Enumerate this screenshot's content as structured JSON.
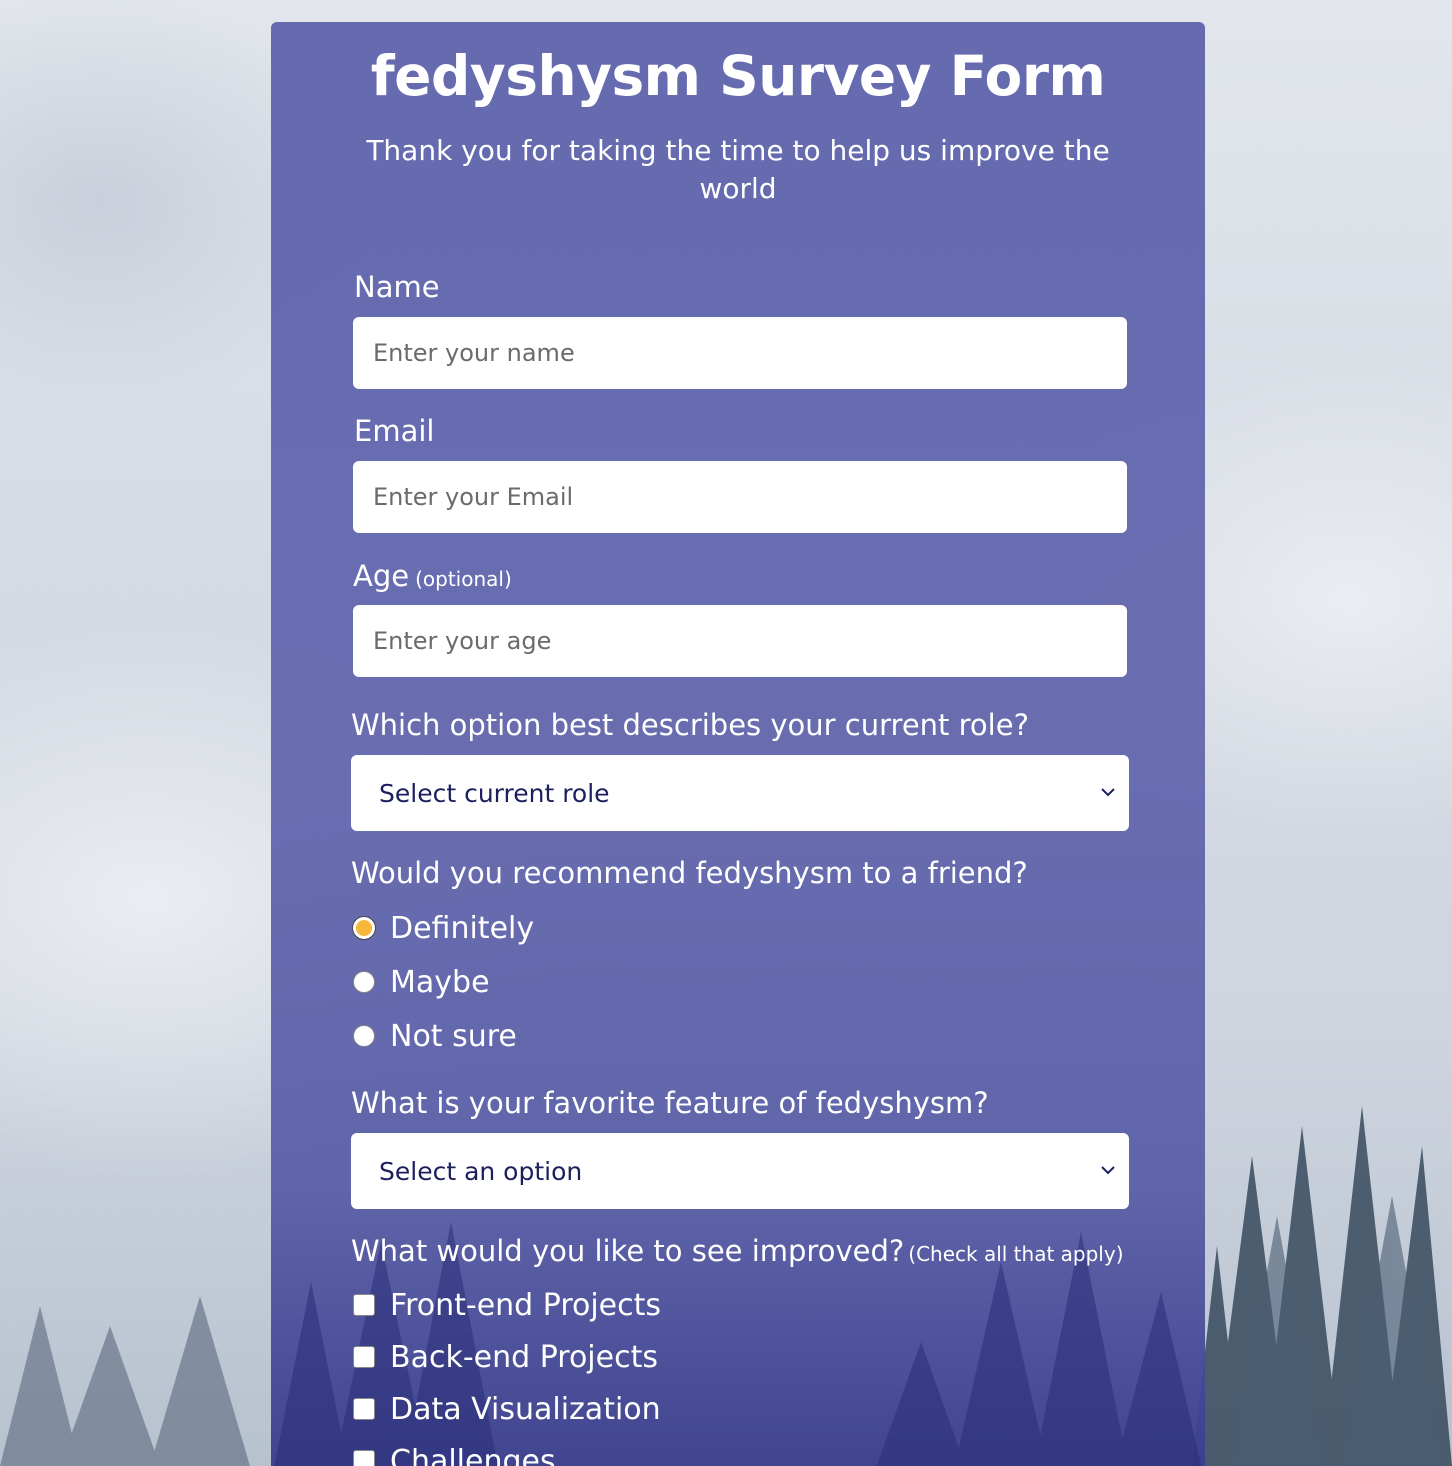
{
  "form": {
    "title": "fedyshysm Survey Form",
    "description": "Thank you for taking the time to help us improve the world",
    "name": {
      "label": "Name",
      "placeholder": "Enter your name"
    },
    "email": {
      "label": "Email",
      "placeholder": "Enter your Email"
    },
    "age": {
      "label": "Age",
      "note": "(optional)",
      "placeholder": "Enter your age"
    },
    "role": {
      "question": "Which option best describes your current role?",
      "selected": "Select current role"
    },
    "recommend": {
      "question": "Would you recommend fedyshysm to a friend?",
      "options": [
        {
          "label": "Definitely",
          "checked": true
        },
        {
          "label": "Maybe",
          "checked": false
        },
        {
          "label": "Not sure",
          "checked": false
        }
      ]
    },
    "feature": {
      "question": "What is your favorite feature of fedyshysm?",
      "selected": "Select an option"
    },
    "improve": {
      "question": "What would you like to see improved?",
      "note": "(Check all that apply)",
      "options": [
        {
          "label": "Front-end Projects",
          "checked": false
        },
        {
          "label": "Back-end Projects",
          "checked": false
        },
        {
          "label": "Data Visualization",
          "checked": false
        },
        {
          "label": "Challenges",
          "checked": false
        }
      ]
    }
  },
  "colors": {
    "card": "#5e62aa",
    "radio_checked": "#f5b73b",
    "select_text": "#1b1f5e"
  }
}
